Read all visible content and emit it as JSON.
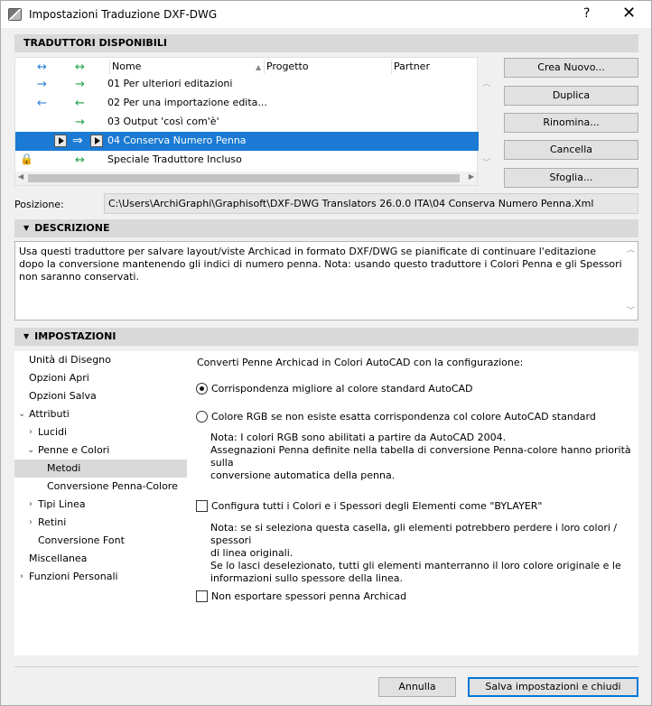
{
  "window": {
    "title": "Impostazioni Traduzione DXF-DWG",
    "help": "?",
    "close": "✕"
  },
  "translators": {
    "section": "TRADUTTORI DISPONIBILI",
    "columns": {
      "nome": "Nome",
      "progetto": "Progetto",
      "partner": "Partner"
    },
    "head_arrows": {
      "a": "↔",
      "b": "↔"
    },
    "rows": [
      {
        "a": "→",
        "b": "→",
        "name": "01 Per ulteriori editazioni"
      },
      {
        "a": "←",
        "b": "←",
        "name": "02 Per una importazione edita..."
      },
      {
        "a": "",
        "b": "→",
        "name": "03 Output 'così com'è'"
      },
      {
        "a": "",
        "b": "⇒",
        "name": "04 Conserva Numero Penna"
      },
      {
        "a": "",
        "b": "↔",
        "name": "Speciale Traduttore Incluso"
      }
    ],
    "selected_index": 3
  },
  "buttons": {
    "new": "Crea Nuovo...",
    "duplicate": "Duplica",
    "rename": "Rinomina...",
    "delete": "Cancella",
    "browse": "Sfoglia..."
  },
  "position": {
    "label": "Posizione:",
    "value": "C:\\Users\\ArchiGraphi\\Graphisoft\\DXF-DWG Translators 26.0.0 ITA\\04 Conserva Numero Penna.Xml"
  },
  "description": {
    "section": "DESCRIZIONE",
    "text": "Usa questi traduttore per salvare layout/viste Archicad in formato DXF/DWG se pianificate di continuare l'editazione dopo la conversione mantenendo gli indici di numero penna. Nota: usando questo traduttore i Colori Penna e gli Spessori non saranno conservati."
  },
  "settings": {
    "section": "IMPOSTAZIONI",
    "tree": [
      "Unità di Disegno",
      "Opzioni Apri",
      "Opzioni Salva",
      "Attributi",
      "Lucidi",
      "Penne e Colori",
      "Metodi",
      "Conversione Penna-Colore",
      "Tipi Linea",
      "Retini",
      "Conversione Font",
      "Miscellanea",
      "Funzioni Personali"
    ],
    "heading": "Converti Penne Archicad in Colori AutoCAD con la configurazione:",
    "radio1": "Corrispondenza migliore al colore standard AutoCAD",
    "radio2": "Colore RGB se non esiste esatta corrispondenza col colore AutoCAD standard",
    "note1_line1": "Nota: I colori RGB sono abilitati a partire da AutoCAD 2004.",
    "note1_line2": "Assegnazioni Penna definite nella tabella di conversione Penna-colore hanno priorità sulla",
    "note1_line3": "conversione automatica della penna.",
    "check1": "Configura tutti i Colori e i Spessori degli Elementi come \"BYLAYER\"",
    "note2_line1": "Nota: se si seleziona questa casella, gli elementi potrebbero perdere i loro colori / spessori",
    "note2_line2": "di linea originali.",
    "note2_line3": "Se lo lasci deselezionato, tutti gli elementi manterranno il loro colore originale e le",
    "note2_line4": "informazioni sullo spessore della linea.",
    "check2": "Non esportare spessori penna Archicad"
  },
  "footer": {
    "cancel": "Annulla",
    "save": "Salva impostazioni e chiudi"
  }
}
